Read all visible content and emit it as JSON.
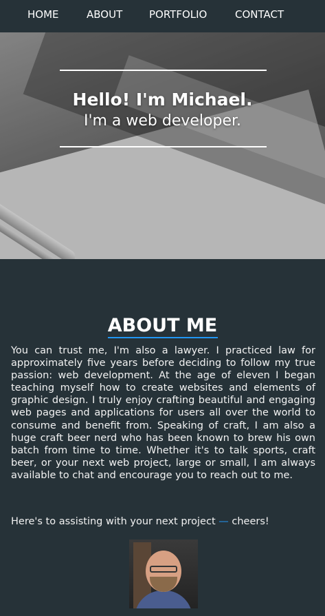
{
  "nav": {
    "items": [
      {
        "label": "HOME"
      },
      {
        "label": "ABOUT"
      },
      {
        "label": "PORTFOLIO"
      },
      {
        "label": "CONTACT"
      }
    ]
  },
  "hero": {
    "headline": "Hello! I'm Michael.",
    "subheadline": "I'm a web developer."
  },
  "about": {
    "title": "ABOUT ME",
    "paragraph1": "You can trust me, I'm also a lawyer. I practiced law for approximately five years before deciding to follow my true passion: web development. At the age of eleven I began teaching myself how to create websites and elements of graphic design. I truly enjoy crafting beautiful and engaging web pages and applications for users all over the world to consume and benefit from. Speaking of craft, I am also a huge craft beer nerd who has been known to brew his own batch from time to time. Whether it's to talk sports, craft beer, or your next web project, large or small, I am always available to chat and encourage you to reach out to me.",
    "paragraph2_start": "Here's to assisting with your next project",
    "paragraph2_dash": "—",
    "paragraph2_end": "cheers!"
  },
  "colors": {
    "background": "#263238",
    "accent": "#2196f3"
  }
}
